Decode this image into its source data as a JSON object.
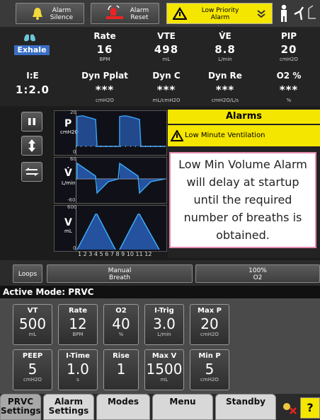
{
  "topbar": {
    "alarm_silence_line1": "Alarm",
    "alarm_silence_line2": "Silence",
    "alarm_reset_line1": "Alarm",
    "alarm_reset_line2": "Reset",
    "priority_line1": "Low Priority",
    "priority_line2": "Alarm"
  },
  "monitor": {
    "phase": "Exhale",
    "row1": [
      {
        "label": "Rate",
        "value": "16",
        "unit": "BPM"
      },
      {
        "label": "VTE",
        "value": "498",
        "unit": "mL"
      },
      {
        "label": "V̇E",
        "value": "8.8",
        "unit": "L/min"
      },
      {
        "label": "PIP",
        "value": "20",
        "unit": "cmH2O"
      }
    ],
    "row2": [
      {
        "label": "I:E",
        "value": "1:2.0",
        "unit": ""
      },
      {
        "label": "Dyn Pplat",
        "value": "***",
        "unit": "cmH2O"
      },
      {
        "label": "Dyn C",
        "value": "***",
        "unit": "mL/cmH2O"
      },
      {
        "label": "Dyn Re",
        "value": "***",
        "unit": "cmH2O/L/s"
      },
      {
        "label": "O2 %",
        "value": "***",
        "unit": "%"
      }
    ]
  },
  "waveforms": {
    "pressure": {
      "symbol": "P",
      "unit": "cmH2O",
      "ymax": "20",
      "ymin": "0"
    },
    "flow": {
      "symbol": "V̇",
      "unit": "L/min",
      "ymax": "60",
      "ymin": "-60"
    },
    "volume": {
      "symbol": "V",
      "unit": "mL",
      "ymax": "600",
      "ymin": "0"
    },
    "x_ticks": [
      "1",
      "2",
      "3",
      "4",
      "5",
      "6",
      "7",
      "8",
      "9",
      "10",
      "11",
      "12"
    ]
  },
  "alarms": {
    "header": "Alarms",
    "active_alarm": "Low Minute Ventilation",
    "message": "Low Min Volume Alarm will delay at startup until the required number of breaths is obtained."
  },
  "actions": {
    "loops": "Loops",
    "manual_breath_line1": "Manual",
    "manual_breath_line2": "Breath",
    "o2_line1": "100%",
    "o2_line2": "O2"
  },
  "mode": {
    "title": "Active Mode: PRVC"
  },
  "settings": {
    "row1": [
      {
        "label": "VT",
        "value": "500",
        "unit": "mL"
      },
      {
        "label": "Rate",
        "value": "12",
        "unit": "BPM"
      },
      {
        "label": "O2",
        "value": "40",
        "unit": "%"
      },
      {
        "label": "I-Trig",
        "value": "3.0",
        "unit": "L/min"
      },
      {
        "label": "Max P",
        "value": "20",
        "unit": "cmH2O"
      }
    ],
    "row2": [
      {
        "label": "PEEP",
        "value": "5",
        "unit": "cmH2O"
      },
      {
        "label": "I-Time",
        "value": "1.0",
        "unit": "s"
      },
      {
        "label": "Rise",
        "value": "1",
        "unit": ""
      },
      {
        "label": "Max V",
        "value": "1500",
        "unit": "mL"
      },
      {
        "label": "Min P",
        "value": "5",
        "unit": "cmH2O"
      }
    ]
  },
  "tabs": {
    "prvc_line1": "PRVC",
    "prvc_line2": "Settings",
    "alarm_line1": "Alarm",
    "alarm_line2": "Settings",
    "modes": "Modes",
    "menu": "Menu",
    "standby": "Standby",
    "help": "?"
  },
  "colors": {
    "alarm_yellow": "#f5e600",
    "phase_blue": "#3a6fc4",
    "wave_fill": "#2d6fd8",
    "alarm_border": "#e38bb0"
  }
}
